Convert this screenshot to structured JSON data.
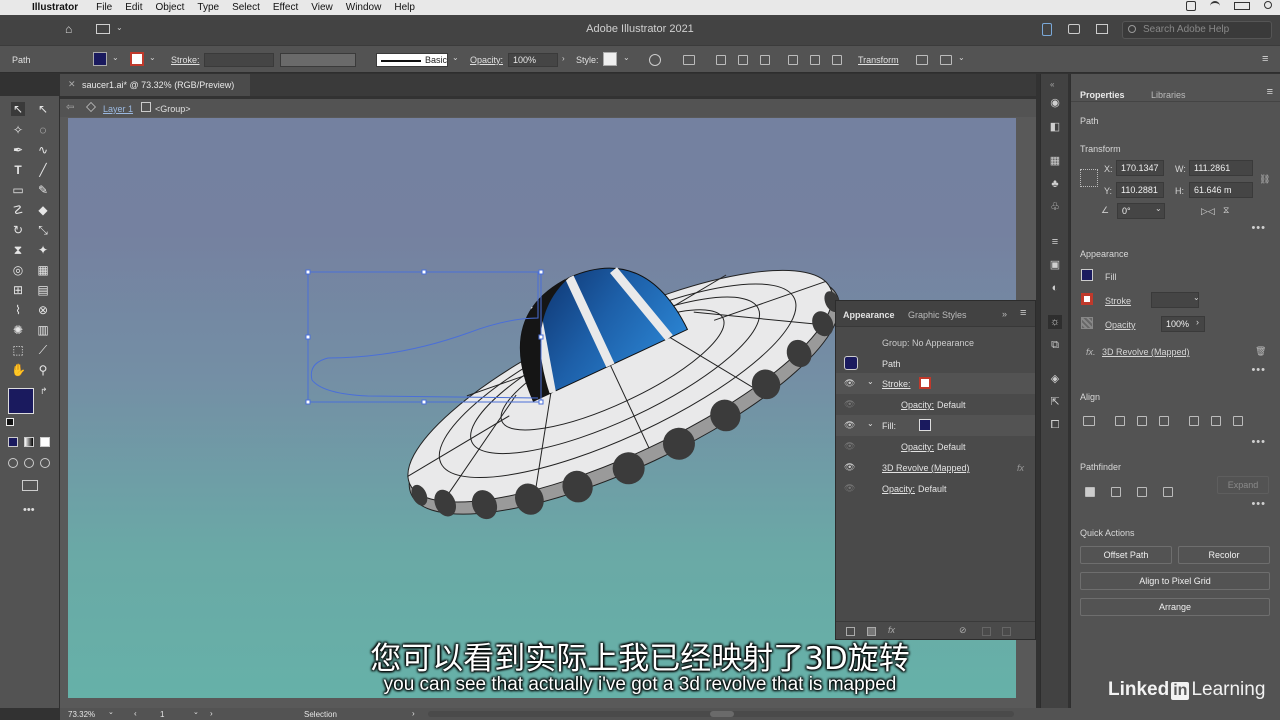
{
  "menubar": {
    "app": "Illustrator",
    "items": [
      "File",
      "Edit",
      "Object",
      "Type",
      "Select",
      "Effect",
      "View",
      "Window",
      "Help"
    ]
  },
  "appbar": {
    "title": "Adobe Illustrator 2021",
    "search_placeholder": "Search Adobe Help"
  },
  "controlbar": {
    "selection_type": "Path",
    "stroke_label": "Stroke:",
    "brush_label": "Basic",
    "opacity_label": "Opacity:",
    "opacity_value": "100%",
    "style_label": "Style:",
    "transform_label": "Transform"
  },
  "document": {
    "tab_title": "saucer1.ai* @ 73.32% (RGB/Preview)"
  },
  "breadcrumb": {
    "layer": "Layer 1",
    "group": "<Group>"
  },
  "properties": {
    "tabs": [
      "Properties",
      "Libraries"
    ],
    "selection": "Path",
    "transform": {
      "title": "Transform",
      "x_label": "X:",
      "x": "170.1347",
      "y_label": "Y:",
      "y": "110.2881",
      "w_label": "W:",
      "w": "111.2861",
      "h_label": "H:",
      "h": "61.646 m",
      "angle": "0°"
    },
    "appearance": {
      "title": "Appearance",
      "fill_label": "Fill",
      "stroke_label": "Stroke",
      "opacity_label": "Opacity",
      "opacity_value": "100%",
      "effect": "3D Revolve (Mapped)"
    },
    "align_title": "Align",
    "pathfinder": {
      "title": "Pathfinder",
      "expand": "Expand"
    },
    "quick_actions": {
      "title": "Quick Actions",
      "offset_path": "Offset Path",
      "recolor": "Recolor",
      "align_pixel": "Align to Pixel Grid",
      "arrange": "Arrange"
    }
  },
  "appearance_panel": {
    "tabs": [
      "Appearance",
      "Graphic Styles"
    ],
    "group_text": "Group: No Appearance",
    "path_label": "Path",
    "stroke_label": "Stroke:",
    "stroke_opacity_label": "Opacity:",
    "stroke_opacity_value": "Default",
    "fill_label": "Fill:",
    "fill_opacity_label": "Opacity:",
    "fill_opacity_value": "Default",
    "effect_label": "3D Revolve (Mapped)",
    "fx": "fx",
    "opacity_label": "Opacity:",
    "opacity_value": "Default"
  },
  "statusbar": {
    "zoom": "73.32%",
    "artboard": "1",
    "tool": "Selection"
  },
  "subtitles": {
    "cn": "您可以看到实际上我已经映射了3D旋转",
    "en": "you can see that actually i've got a 3d revolve that is mapped"
  },
  "logo": {
    "word1": "Linked",
    "word2": "in",
    "word3": "Learning"
  },
  "colors": {
    "fill": "#1a1a5e",
    "stroke": "#c0392b",
    "canvas_top": "#7481a0",
    "canvas_bottom": "#66b1a8",
    "dome": "#1d5fa8"
  }
}
